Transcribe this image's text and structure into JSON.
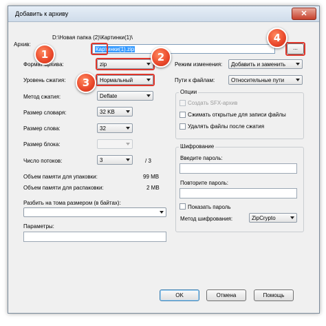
{
  "window": {
    "title": "Добавить к архиву",
    "close_label": "✕"
  },
  "archive": {
    "label": "Архив:",
    "path": "D:\\Новая папка (2)\\Картинки(1)\\",
    "filename": "Картинки(1).zip",
    "browse_label": "..."
  },
  "left": {
    "format_label": "Формат архива:",
    "format_value": "zip",
    "level_label": "Уровень сжатия:",
    "level_value": "Нормальный",
    "method_label": "Метод сжатия:",
    "method_value": "Deflate",
    "dict_label": "Размер словаря:",
    "dict_value": "32 KB",
    "word_label": "Размер слова:",
    "word_value": "32",
    "block_label": "Размер блока:",
    "block_value": "",
    "threads_label": "Число потоков:",
    "threads_value": "3",
    "threads_total": "/ 3",
    "mem_pack_label": "Объем памяти для упаковки:",
    "mem_pack_value": "99 MB",
    "mem_unpack_label": "Объем памяти для распаковки:",
    "mem_unpack_value": "2 MB",
    "split_label": "Разбить на тома размером (в байтах):",
    "params_label": "Параметры:"
  },
  "right": {
    "update_mode_label": "Режим изменения:",
    "update_mode_value": "Добавить и заменить",
    "paths_label": "Пути к файлам:",
    "paths_value": "Относительные пути",
    "options_title": "Опции",
    "opt_sfx": "Создать SFX-архив",
    "opt_shared": "Сжимать открытые для записи файлы",
    "opt_delete": "Удалять файлы после сжатия",
    "enc_title": "Шифрование",
    "enc_password_label": "Введите пароль:",
    "enc_repeat_label": "Повторите пароль:",
    "enc_show_label": "Показать пароль",
    "enc_method_label": "Метод шифрования:",
    "enc_method_value": "ZipCrypto"
  },
  "buttons": {
    "ok": "OK",
    "cancel": "Отмена",
    "help": "Помощь"
  },
  "annotations": {
    "b1": "1",
    "b2": "2",
    "b3": "3",
    "b4": "4"
  },
  "colors": {
    "annotation_red": "#e0362b",
    "title_gradient_top": "#e6eef7",
    "dialog_bg": "#f0f0f0"
  }
}
